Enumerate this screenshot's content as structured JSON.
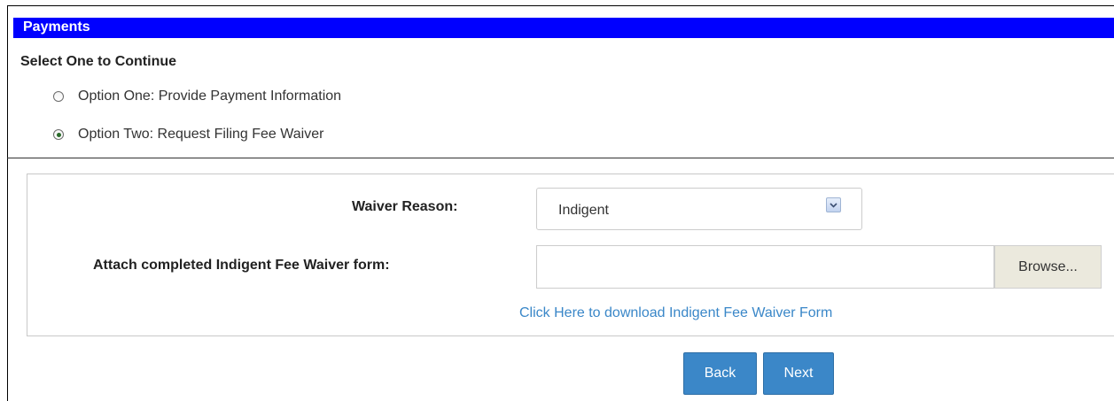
{
  "header": {
    "title": "Payments"
  },
  "selection": {
    "title": "Select One to Continue",
    "options": [
      {
        "label": "Option One: Provide Payment Information",
        "checked": false
      },
      {
        "label": "Option Two: Request Filing Fee Waiver",
        "checked": true
      }
    ]
  },
  "waiver": {
    "reason_label": "Waiver Reason:",
    "reason_value": "Indigent",
    "attach_label": "Attach completed Indigent Fee Waiver form:",
    "file_value": "",
    "browse_label": "Browse...",
    "download_link": "Click Here to download Indigent Fee Waiver Form"
  },
  "actions": {
    "back_label": "Back",
    "next_label": "Next"
  },
  "colors": {
    "header_bg": "#0000ff",
    "button_bg": "#3b87c8",
    "link": "#3a87c8"
  }
}
